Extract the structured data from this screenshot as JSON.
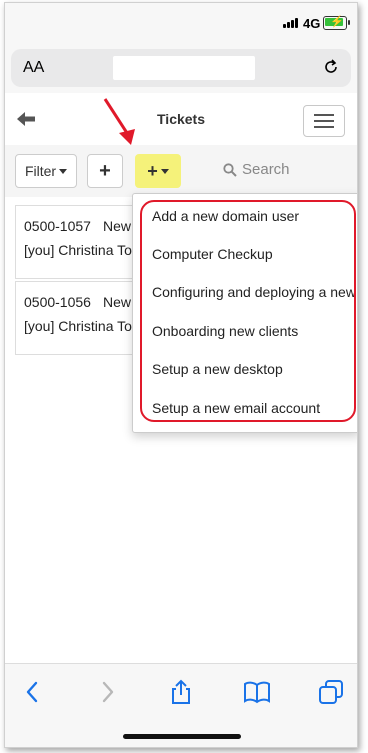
{
  "status_bar": {
    "network": "4G"
  },
  "url_bar": {
    "text_size_label": "AA"
  },
  "header": {
    "title": "Tickets"
  },
  "toolbar": {
    "filter_label": "Filter",
    "add_label": "+",
    "template_add_label": "+",
    "search_placeholder": "Search"
  },
  "tickets": [
    {
      "number": "0500-1057",
      "subject": "New",
      "assignee": "[you]  Christina Tor"
    },
    {
      "number": "0500-1056",
      "subject": "New",
      "assignee": "[you]  Christina Tor"
    }
  ],
  "dropdown": {
    "items": [
      "Add a new domain user",
      "Computer Checkup",
      "Configuring and deploying a new s",
      "Onboarding new clients",
      "Setup a new desktop",
      "Setup a new email account"
    ]
  },
  "colors": {
    "highlight": "#f5f27a",
    "annotation_red": "#e0192a",
    "ios_blue": "#1a73e8"
  }
}
